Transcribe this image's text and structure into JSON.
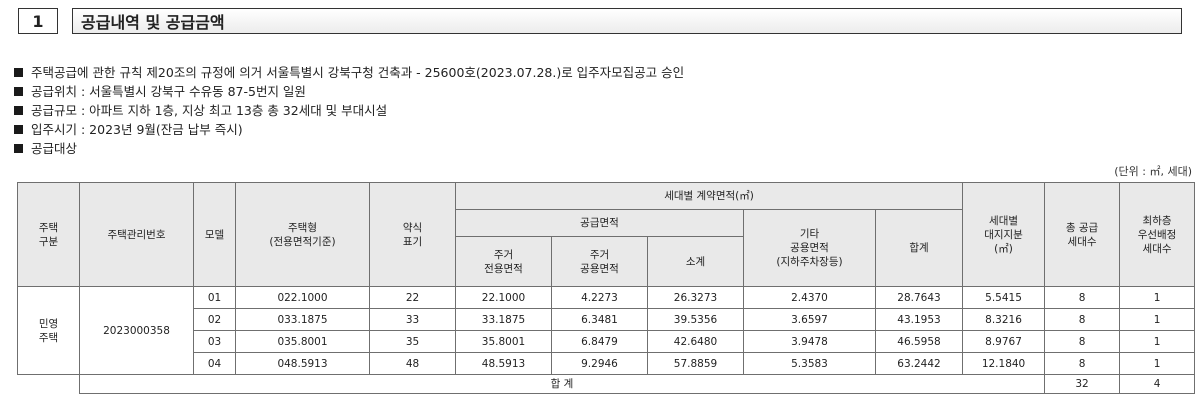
{
  "section": {
    "number": "1",
    "title": "공급내역 및 공급금액"
  },
  "bullets": [
    "주택공급에 관한 규칙 제20조의 규정에 의거 서울특별시 강북구청 건축과 - 25600호(2023.07.28.)로 입주자모집공고 승인",
    "공급위치 : 서울특별시 강북구 수유동 87-5번지 일원",
    "공급규모 : 아파트 지하 1층, 지상  최고 13층 총 32세대 및 부대시설",
    "입주시기 : 2023년 9월(잔금 납부 즉시)",
    "공급대상"
  ],
  "unit_note": "(단위 : ㎡, 세대)",
  "table": {
    "headers": {
      "housing_type": "주택\n구분",
      "mgmt_no": "주택관리번호",
      "model": "모델",
      "house_type": "주택형\n(전용면적기준)",
      "abbr": "약식\n표기",
      "contract_area": "세대별 계약면적(㎡)",
      "supply_area": "공급면적",
      "exclusive": "주거\n전용면적",
      "common": "주거\n공용면적",
      "subtotal": "소계",
      "other_common": "기타\n공용면적\n(지하주차장등)",
      "sum": "합계",
      "land_share": "세대별\n대지지분\n(㎡)",
      "total_units": "총 공급\n세대수",
      "min_priority": "최하층\n우선배정\n세대수"
    },
    "housing_type_value": "민영\n주택",
    "mgmt_no_value": "2023000358",
    "rows": [
      {
        "model": "01",
        "house_type": "022.1000",
        "abbr": "22",
        "exclusive": "22.1000",
        "common": "4.2273",
        "subtotal": "26.3273",
        "other_common": "2.4370",
        "sum": "28.7643",
        "land_share": "5.5415",
        "total_units": "8",
        "min_priority": "1"
      },
      {
        "model": "02",
        "house_type": "033.1875",
        "abbr": "33",
        "exclusive": "33.1875",
        "common": "6.3481",
        "subtotal": "39.5356",
        "other_common": "3.6597",
        "sum": "43.1953",
        "land_share": "8.3216",
        "total_units": "8",
        "min_priority": "1"
      },
      {
        "model": "03",
        "house_type": "035.8001",
        "abbr": "35",
        "exclusive": "35.8001",
        "common": "6.8479",
        "subtotal": "42.6480",
        "other_common": "3.9478",
        "sum": "46.5958",
        "land_share": "8.9767",
        "total_units": "8",
        "min_priority": "1"
      },
      {
        "model": "04",
        "house_type": "048.5913",
        "abbr": "48",
        "exclusive": "48.5913",
        "common": "9.2946",
        "subtotal": "57.8859",
        "other_common": "5.3583",
        "sum": "63.2442",
        "land_share": "12.1840",
        "total_units": "8",
        "min_priority": "1"
      }
    ],
    "total_row": {
      "label": "합 계",
      "total_units": "32",
      "min_priority": "4"
    }
  }
}
